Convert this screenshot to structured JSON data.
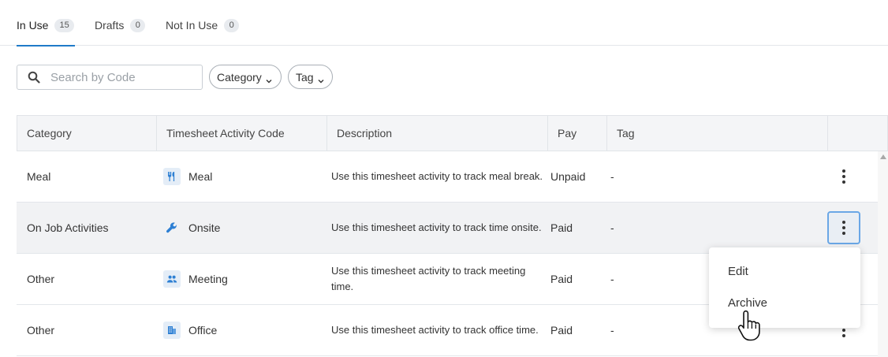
{
  "tabs": [
    {
      "label": "In Use",
      "count": "15"
    },
    {
      "label": "Drafts",
      "count": "0"
    },
    {
      "label": "Not In Use",
      "count": "0"
    }
  ],
  "filters": {
    "search_placeholder": "Search by Code",
    "search_icon": "search-icon",
    "category_label": "Category",
    "tag_label": "Tag"
  },
  "table": {
    "headers": [
      "Category",
      "Timesheet Activity Code",
      "Description",
      "Pay",
      "Tag"
    ],
    "rows": [
      {
        "category": "Meal",
        "code": "Meal",
        "icon": "fork-knife-icon",
        "description": "Use this timesheet activity to track meal break.",
        "pay": "Unpaid",
        "tag": "-"
      },
      {
        "category": "On Job Activities",
        "code": "Onsite",
        "icon": "wrench-icon",
        "description": "Use this timesheet activity to track time onsite.",
        "pay": "Paid",
        "tag": "-"
      },
      {
        "category": "Other",
        "code": "Meeting",
        "icon": "people-icon",
        "description": "Use this timesheet activity to track meeting time.",
        "pay": "Paid",
        "tag": "-"
      },
      {
        "category": "Other",
        "code": "Office",
        "icon": "building-icon",
        "description": "Use this timesheet activity to track office time.",
        "pay": "Paid",
        "tag": "-"
      }
    ]
  },
  "context_menu": {
    "items": [
      "Edit",
      "Archive"
    ]
  },
  "colors": {
    "accent": "#1f7ac8",
    "icon_blue": "#2d7fd3",
    "header_bg": "#f4f5f7",
    "highlight_row": "#f1f2f4"
  }
}
